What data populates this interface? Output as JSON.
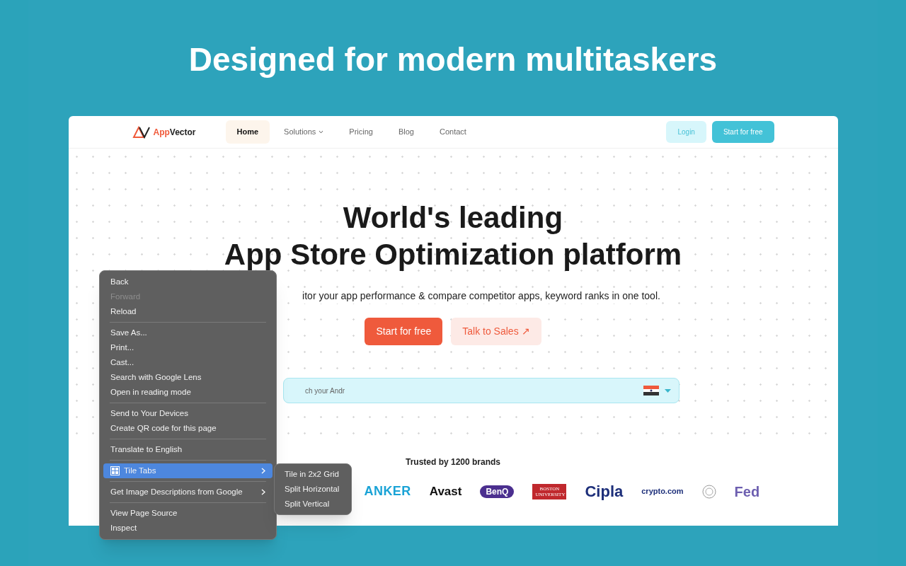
{
  "headline": "Designed for modern multitaskers",
  "site": {
    "logo": "AppVector",
    "nav": [
      {
        "label": "Home",
        "selected": true,
        "dropdown": false
      },
      {
        "label": "Solutions",
        "selected": false,
        "dropdown": true
      },
      {
        "label": "Pricing",
        "selected": false,
        "dropdown": false
      },
      {
        "label": "Blog",
        "selected": false,
        "dropdown": false
      },
      {
        "label": "Contact",
        "selected": false,
        "dropdown": false
      }
    ],
    "login": "Login",
    "start": "Start for free",
    "hero_lines": [
      "World's leading",
      "App Store Optimization platform"
    ],
    "subtitle": "itor your app performance & compare competitor apps, keyword ranks in one tool.",
    "cta_primary": "Start for free",
    "cta_secondary": "Talk to Sales ↗",
    "search": {
      "placeholder": "ch your Andr"
    },
    "trusted": "Trusted by 1200 brands",
    "brands": [
      {
        "kind": "text",
        "label": "ANKER"
      },
      {
        "kind": "text",
        "label": "Avast"
      },
      {
        "kind": "text",
        "label": "BenQ"
      },
      {
        "kind": "text",
        "label": "BOSTON UNIVERSITY"
      },
      {
        "kind": "text",
        "label": "Cipla"
      },
      {
        "kind": "text",
        "label": "crypto.com"
      },
      {
        "kind": "seal"
      },
      {
        "kind": "text",
        "label": "Fed"
      }
    ]
  },
  "menu": [
    {
      "kind": "item",
      "label": "Back",
      "disabled": false,
      "highlighted": false,
      "submenu": false
    },
    {
      "kind": "item",
      "label": "Forward",
      "disabled": true,
      "highlighted": false,
      "submenu": false
    },
    {
      "kind": "item",
      "label": "Reload",
      "disabled": false,
      "highlighted": false,
      "submenu": false
    },
    {
      "kind": "separator"
    },
    {
      "kind": "item",
      "label": "Save As...",
      "disabled": false,
      "highlighted": false,
      "submenu": false
    },
    {
      "kind": "item",
      "label": "Print...",
      "disabled": false,
      "highlighted": false,
      "submenu": false
    },
    {
      "kind": "item",
      "label": "Cast...",
      "disabled": false,
      "highlighted": false,
      "submenu": false
    },
    {
      "kind": "item",
      "label": "Search with Google Lens",
      "disabled": false,
      "highlighted": false,
      "submenu": false
    },
    {
      "kind": "item",
      "label": "Open in reading mode",
      "disabled": false,
      "highlighted": false,
      "submenu": false
    },
    {
      "kind": "separator"
    },
    {
      "kind": "item",
      "label": "Send to Your Devices",
      "disabled": false,
      "highlighted": false,
      "submenu": false
    },
    {
      "kind": "item",
      "label": "Create QR code for this page",
      "disabled": false,
      "highlighted": false,
      "submenu": false
    },
    {
      "kind": "separator"
    },
    {
      "kind": "item",
      "label": "Translate to English",
      "disabled": false,
      "highlighted": false,
      "submenu": false
    },
    {
      "kind": "separator"
    },
    {
      "kind": "item",
      "label": "Tile Tabs",
      "disabled": false,
      "highlighted": true,
      "submenu": true,
      "icon": true
    },
    {
      "kind": "separator"
    },
    {
      "kind": "item",
      "label": "Get Image Descriptions from Google",
      "disabled": false,
      "highlighted": false,
      "submenu": true
    },
    {
      "kind": "separator"
    },
    {
      "kind": "item",
      "label": "View Page Source",
      "disabled": false,
      "highlighted": false,
      "submenu": false
    },
    {
      "kind": "item",
      "label": "Inspect",
      "disabled": false,
      "highlighted": false,
      "submenu": false
    }
  ],
  "submenu": [
    "Tile in 2x2 Grid",
    "Split Horizontal",
    "Split Vertical"
  ]
}
